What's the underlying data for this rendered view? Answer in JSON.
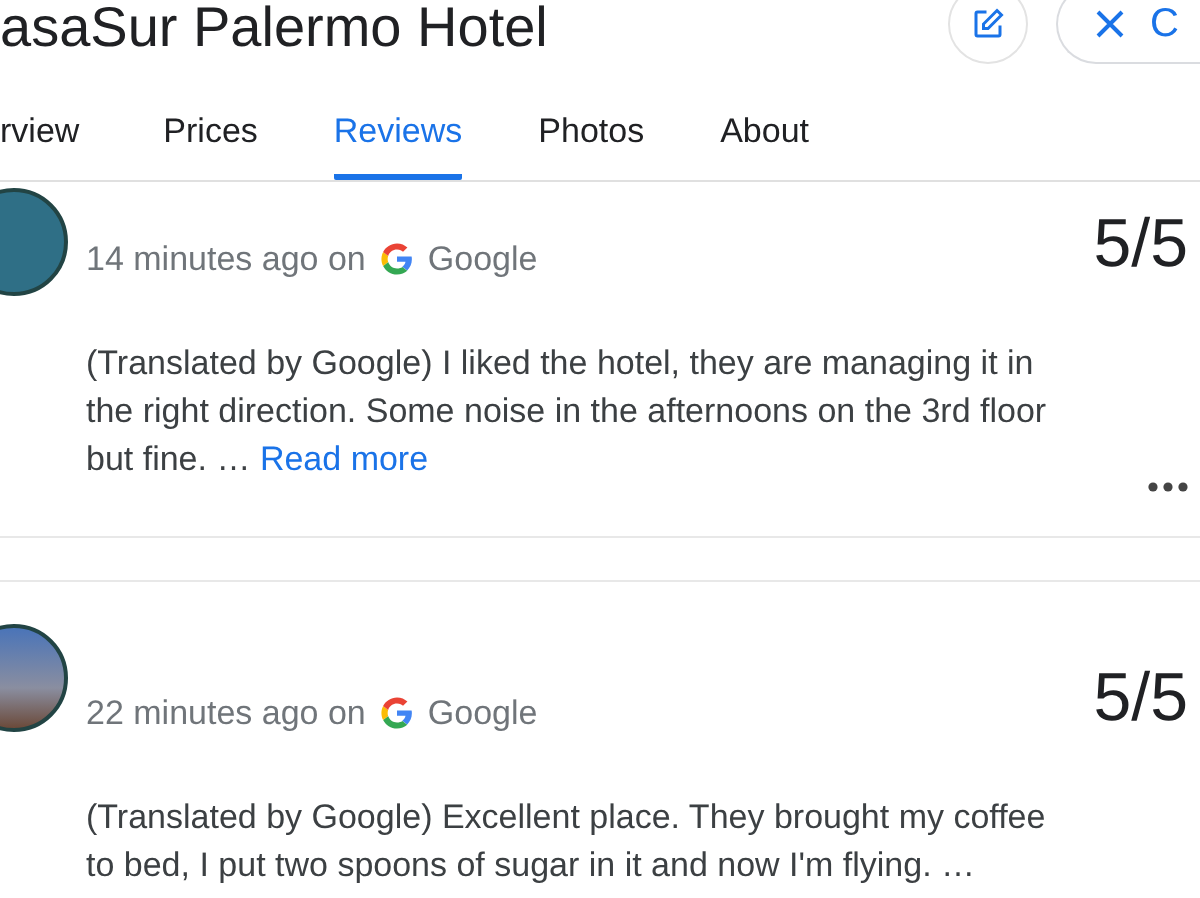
{
  "header": {
    "title": "asaSur Palermo Hotel",
    "close_button": {
      "label": "C"
    }
  },
  "tabs": [
    {
      "label": "rview",
      "selected": false
    },
    {
      "label": "Prices",
      "selected": false
    },
    {
      "label": "Reviews",
      "selected": true
    },
    {
      "label": "Photos",
      "selected": false
    },
    {
      "label": "About",
      "selected": false
    }
  ],
  "reviews": [
    {
      "time": "14 minutes ago on",
      "source": "Google",
      "rating": "5/5",
      "text": "(Translated by Google) I liked the hotel, they are managing it in the right direction. Some noise in the afternoons on the 3rd floor but fine. …",
      "read_more": "Read more",
      "avatar": {
        "kind": "cartoon"
      }
    },
    {
      "time": "22 minutes ago on",
      "source": "Google",
      "rating": "5/5",
      "text": "(Translated by Google) Excellent place. They brought my coffee to bed, I put two spoons of sugar in it and now I'm flying. …",
      "avatar": {
        "kind": "photo"
      }
    }
  ]
}
